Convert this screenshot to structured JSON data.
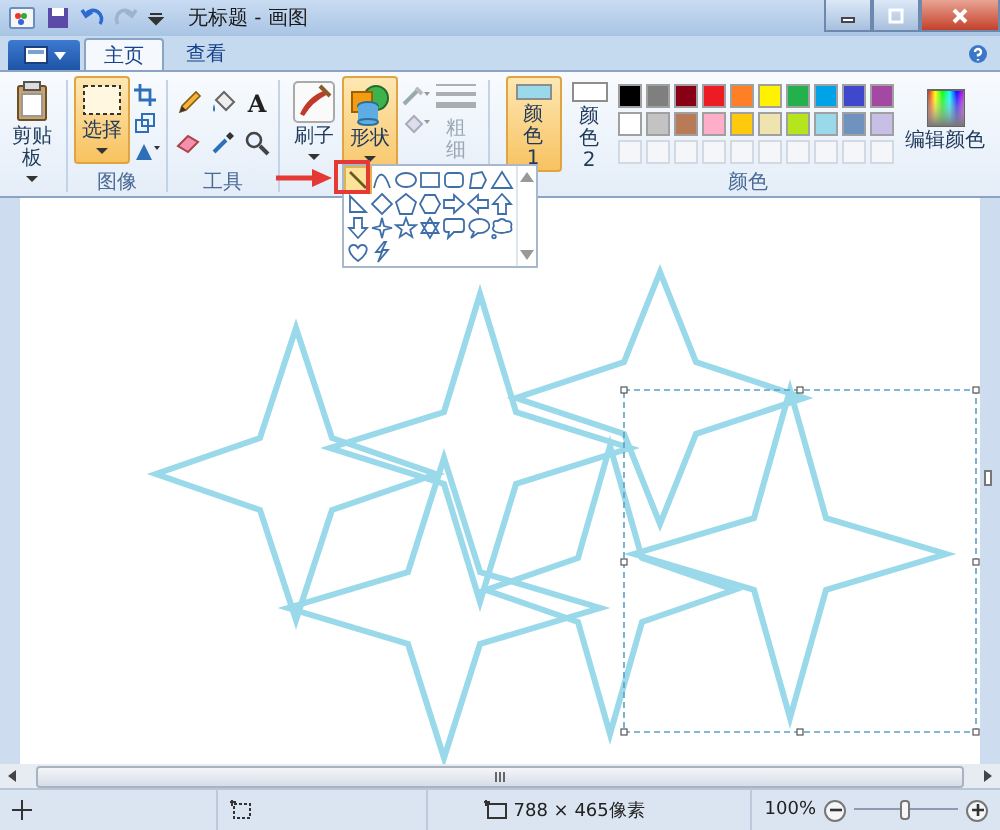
{
  "window": {
    "title": "无标题 - 画图"
  },
  "tabs": [
    {
      "label": "主页",
      "selected": true
    },
    {
      "label": "查看",
      "selected": false
    }
  ],
  "ribbon": {
    "clipboard": {
      "label": "剪贴板"
    },
    "image": {
      "select_label": "选择",
      "group_label": "图像"
    },
    "tools": {
      "text_glyph": "A",
      "group_label": "工具"
    },
    "brushes": {
      "label": "刷子"
    },
    "shapes": {
      "label": "形状",
      "expanded": true
    },
    "size": {
      "label": "粗细",
      "disabled": true
    },
    "color1": {
      "label": "颜色 1",
      "color": "#99d9ea",
      "selected": true
    },
    "color2": {
      "label": "颜色 2",
      "color": "#ffffff",
      "selected": false
    },
    "palette": [
      {
        "color": "#000000"
      },
      {
        "color": "#7f7f7f"
      },
      {
        "color": "#880015"
      },
      {
        "color": "#ed1c24"
      },
      {
        "color": "#ff7f27"
      },
      {
        "color": "#fff200"
      },
      {
        "color": "#22b14c"
      },
      {
        "color": "#00a2e8"
      },
      {
        "color": "#3f48cc"
      },
      {
        "color": "#a349a4"
      },
      {
        "color": "#ffffff"
      },
      {
        "color": "#c3c3c3"
      },
      {
        "color": "#b97a57"
      },
      {
        "color": "#ffaec9"
      },
      {
        "color": "#ffc90e"
      },
      {
        "color": "#efe4b0"
      },
      {
        "color": "#b5e61d"
      },
      {
        "color": "#99d9ea"
      },
      {
        "color": "#7092be"
      },
      {
        "color": "#c8bfe7"
      }
    ],
    "colors_group_label": "颜色",
    "edit_colors": {
      "label": "编辑颜色"
    }
  },
  "shape_gallery": [
    {
      "kind": "line",
      "selected": true
    },
    {
      "kind": "curve",
      "selected": false
    },
    {
      "kind": "oval",
      "selected": false
    },
    {
      "kind": "rectangle",
      "selected": false
    },
    {
      "kind": "rounded-rectangle",
      "selected": false
    },
    {
      "kind": "polygon",
      "selected": false
    },
    {
      "kind": "triangle",
      "selected": false
    },
    {
      "kind": "right-triangle",
      "selected": false
    },
    {
      "kind": "diamond",
      "selected": false
    },
    {
      "kind": "pentagon",
      "selected": false
    },
    {
      "kind": "hexagon",
      "selected": false
    },
    {
      "kind": "right-arrow",
      "selected": false
    },
    {
      "kind": "left-arrow",
      "selected": false
    },
    {
      "kind": "up-arrow",
      "selected": false
    },
    {
      "kind": "down-arrow",
      "selected": false
    },
    {
      "kind": "four-point-star",
      "selected": false
    },
    {
      "kind": "five-point-star",
      "selected": false
    },
    {
      "kind": "six-point-star",
      "selected": false
    },
    {
      "kind": "rounded-callout",
      "selected": false
    },
    {
      "kind": "oval-callout",
      "selected": false
    },
    {
      "kind": "cloud-callout",
      "selected": false
    },
    {
      "kind": "heart",
      "selected": false
    },
    {
      "kind": "lightning",
      "selected": false
    }
  ],
  "status_bar": {
    "image_size": "788 × 465像素",
    "zoom": "100%",
    "zoom_slider": {
      "level": 0.5
    }
  }
}
